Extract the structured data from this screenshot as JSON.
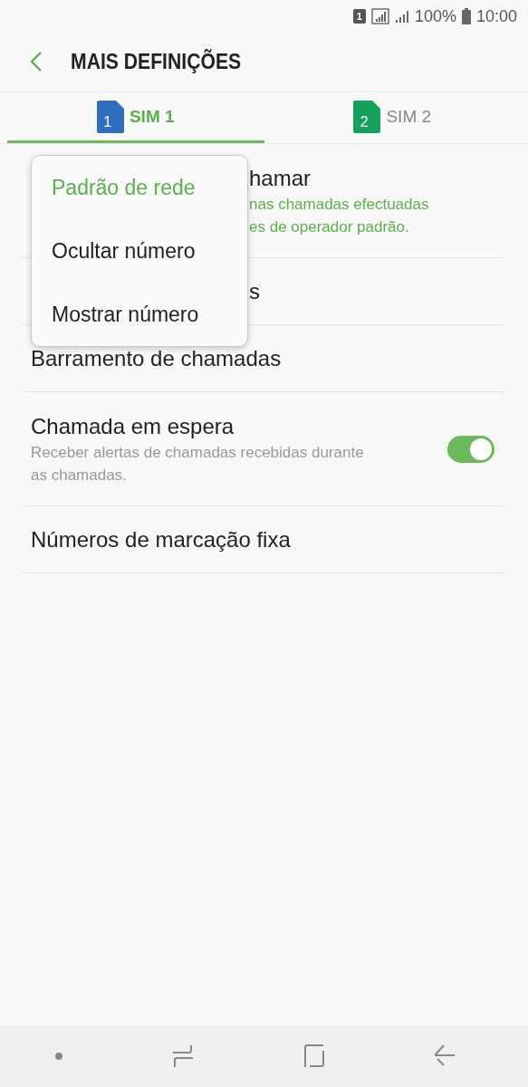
{
  "status_bar": {
    "sim": "1",
    "battery": "100%",
    "time": "10:00"
  },
  "header": {
    "title": "MAIS DEFINIÇÕES"
  },
  "tabs": [
    {
      "label": "SIM 1",
      "number": "1",
      "selected": true
    },
    {
      "label": "SIM 2",
      "number": "2",
      "selected": false
    }
  ],
  "settings": [
    {
      "title": "hamar",
      "subtitle_lines": [
        "nas chamadas efectuadas",
        "es de operador padrão."
      ]
    },
    {
      "title": "s"
    },
    {
      "title": "Barramento de chamadas"
    },
    {
      "title": "Chamada em espera",
      "subtitle_lines": [
        "Receber alertas de chamadas recebidas durante",
        "as chamadas."
      ],
      "on": true
    },
    {
      "title": "Números de marcação fixa"
    }
  ],
  "menu": [
    {
      "label": "Padrão de rede",
      "selected": true
    },
    {
      "label": "Ocultar número",
      "selected": false
    },
    {
      "label": "Mostrar número",
      "selected": false
    }
  ]
}
